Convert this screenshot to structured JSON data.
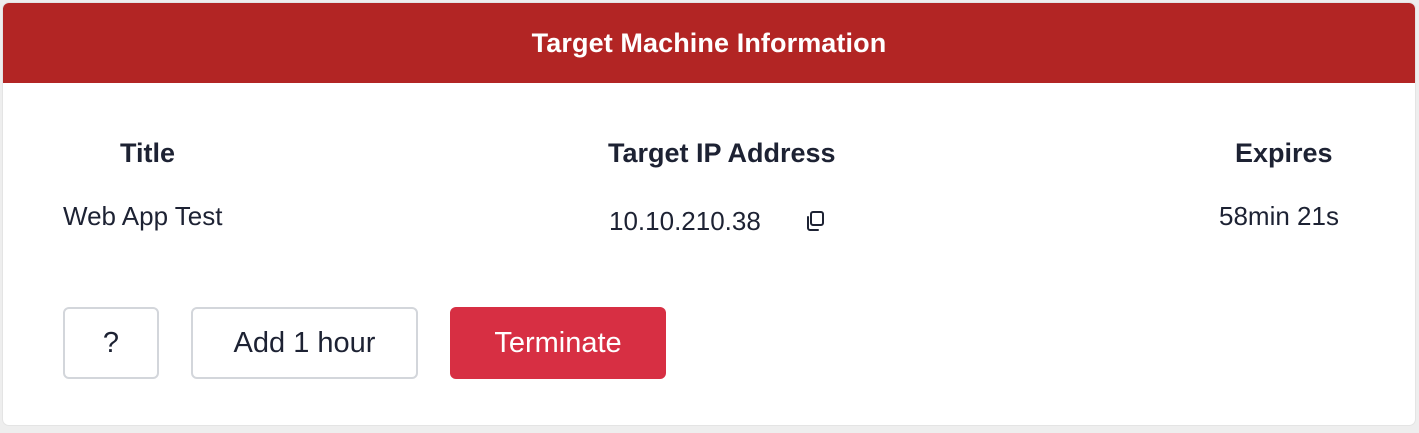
{
  "panel": {
    "title": "Target Machine Information"
  },
  "columns": {
    "title_header": "Title",
    "ip_header": "Target IP Address",
    "expires_header": "Expires"
  },
  "machine": {
    "title": "Web App Test",
    "ip_address": "10.10.210.38",
    "expires": "58min 21s"
  },
  "actions": {
    "help_label": "?",
    "add_hour_label": "Add 1 hour",
    "terminate_label": "Terminate"
  },
  "icons": {
    "copy": "copy-icon"
  },
  "colors": {
    "header_bg": "#b22524",
    "terminate_bg": "#d72f43",
    "text": "#1d2233"
  }
}
